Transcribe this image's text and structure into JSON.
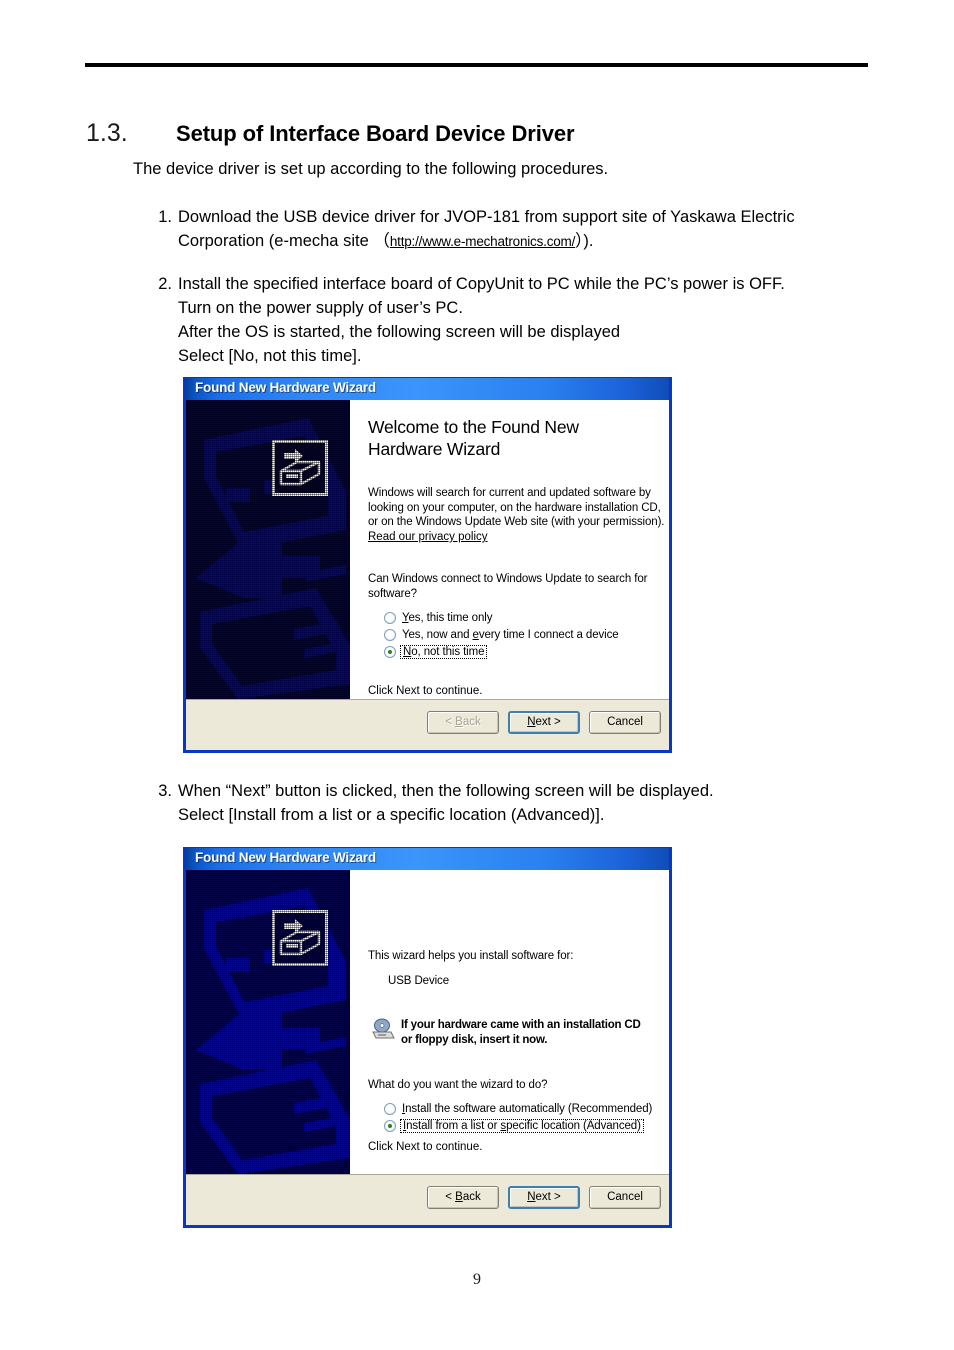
{
  "document": {
    "heading_number": "1.3.",
    "heading_title": "Setup of Interface Board Device Driver",
    "intro": "The device driver is set up according to the following procedures.",
    "page_number": "9"
  },
  "steps": [
    {
      "number": "1.",
      "line_a": "Download the USB device driver for JVOP-181 from support site of Yaskawa Electric",
      "line_b_pre": "Corporation (e-mecha site （",
      "url": "http://www.e-mechatronics.com/",
      "line_b_post": "）)."
    },
    {
      "number": "2.",
      "line_a": "Install the specified interface board of CopyUnit to PC while the PC’s power is OFF.",
      "line_b": "Turn on the power supply of user’s PC.",
      "line_c": "After the OS is started, the following screen will be displayed",
      "line_d": "Select [No, not this time]."
    },
    {
      "number": "3.",
      "line_a": "When “Next” button is clicked, then the following screen will be displayed.",
      "line_b": "Select [Install from a list or a specific location (Advanced)]."
    }
  ],
  "wizard1": {
    "title": "Found New Hardware Wizard",
    "welcome_line1": "Welcome to the Found New",
    "welcome_line2": "Hardware Wizard",
    "paragraph": "Windows will search for current and updated software by looking on your computer, on the hardware installation CD, or on the Windows Update Web site (with your permission).",
    "privacy_link": "Read our privacy policy",
    "question": "Can Windows connect to Windows Update to search for software?",
    "options": [
      {
        "label_a": "Y",
        "label_b": "es, this time only",
        "checked": false
      },
      {
        "label_a": "Yes, now and ",
        "label_b": "e",
        "label_c": "very time I connect a device",
        "checked": false
      },
      {
        "label_a": "N",
        "label_b": "o, not this time",
        "checked": true
      }
    ],
    "click_next": "Click Next to continue.",
    "buttons": {
      "back": "< Back",
      "back_mnemonic": "B",
      "next": "Next >",
      "next_mnemonic": "N",
      "cancel": "Cancel"
    }
  },
  "wizard2": {
    "title": "Found New Hardware Wizard",
    "helps_text": "This wizard helps you install software for:",
    "device_name": "USB Device",
    "cd_note_line1": "If your hardware came with an installation CD",
    "cd_note_line2": "or floppy disk, insert it now.",
    "question": "What do you want the wizard to do?",
    "options": [
      {
        "label_a": "I",
        "label_b": "nstall the software automatically (Recommended)",
        "checked": false
      },
      {
        "label_a": "I",
        "label_b": "nstall from a list or ",
        "label_c": "s",
        "label_d": "pecific location (Advanced)",
        "checked": true
      }
    ],
    "click_next": "Click Next to continue.",
    "buttons": {
      "back": "< Back",
      "back_mnemonic": "B",
      "next": "Next >",
      "next_mnemonic": "N",
      "cancel": "Cancel"
    }
  },
  "colors": {
    "titlebar_blue": "#1a6ee8",
    "banner_navy": "#000066",
    "banner_art_blue": "#0000cc",
    "dialog_face": "#ece9d8",
    "window_border": "#0a36c8",
    "radio_dot_green": "#1f8a1f",
    "default_button_border": "#3c7fb1"
  }
}
